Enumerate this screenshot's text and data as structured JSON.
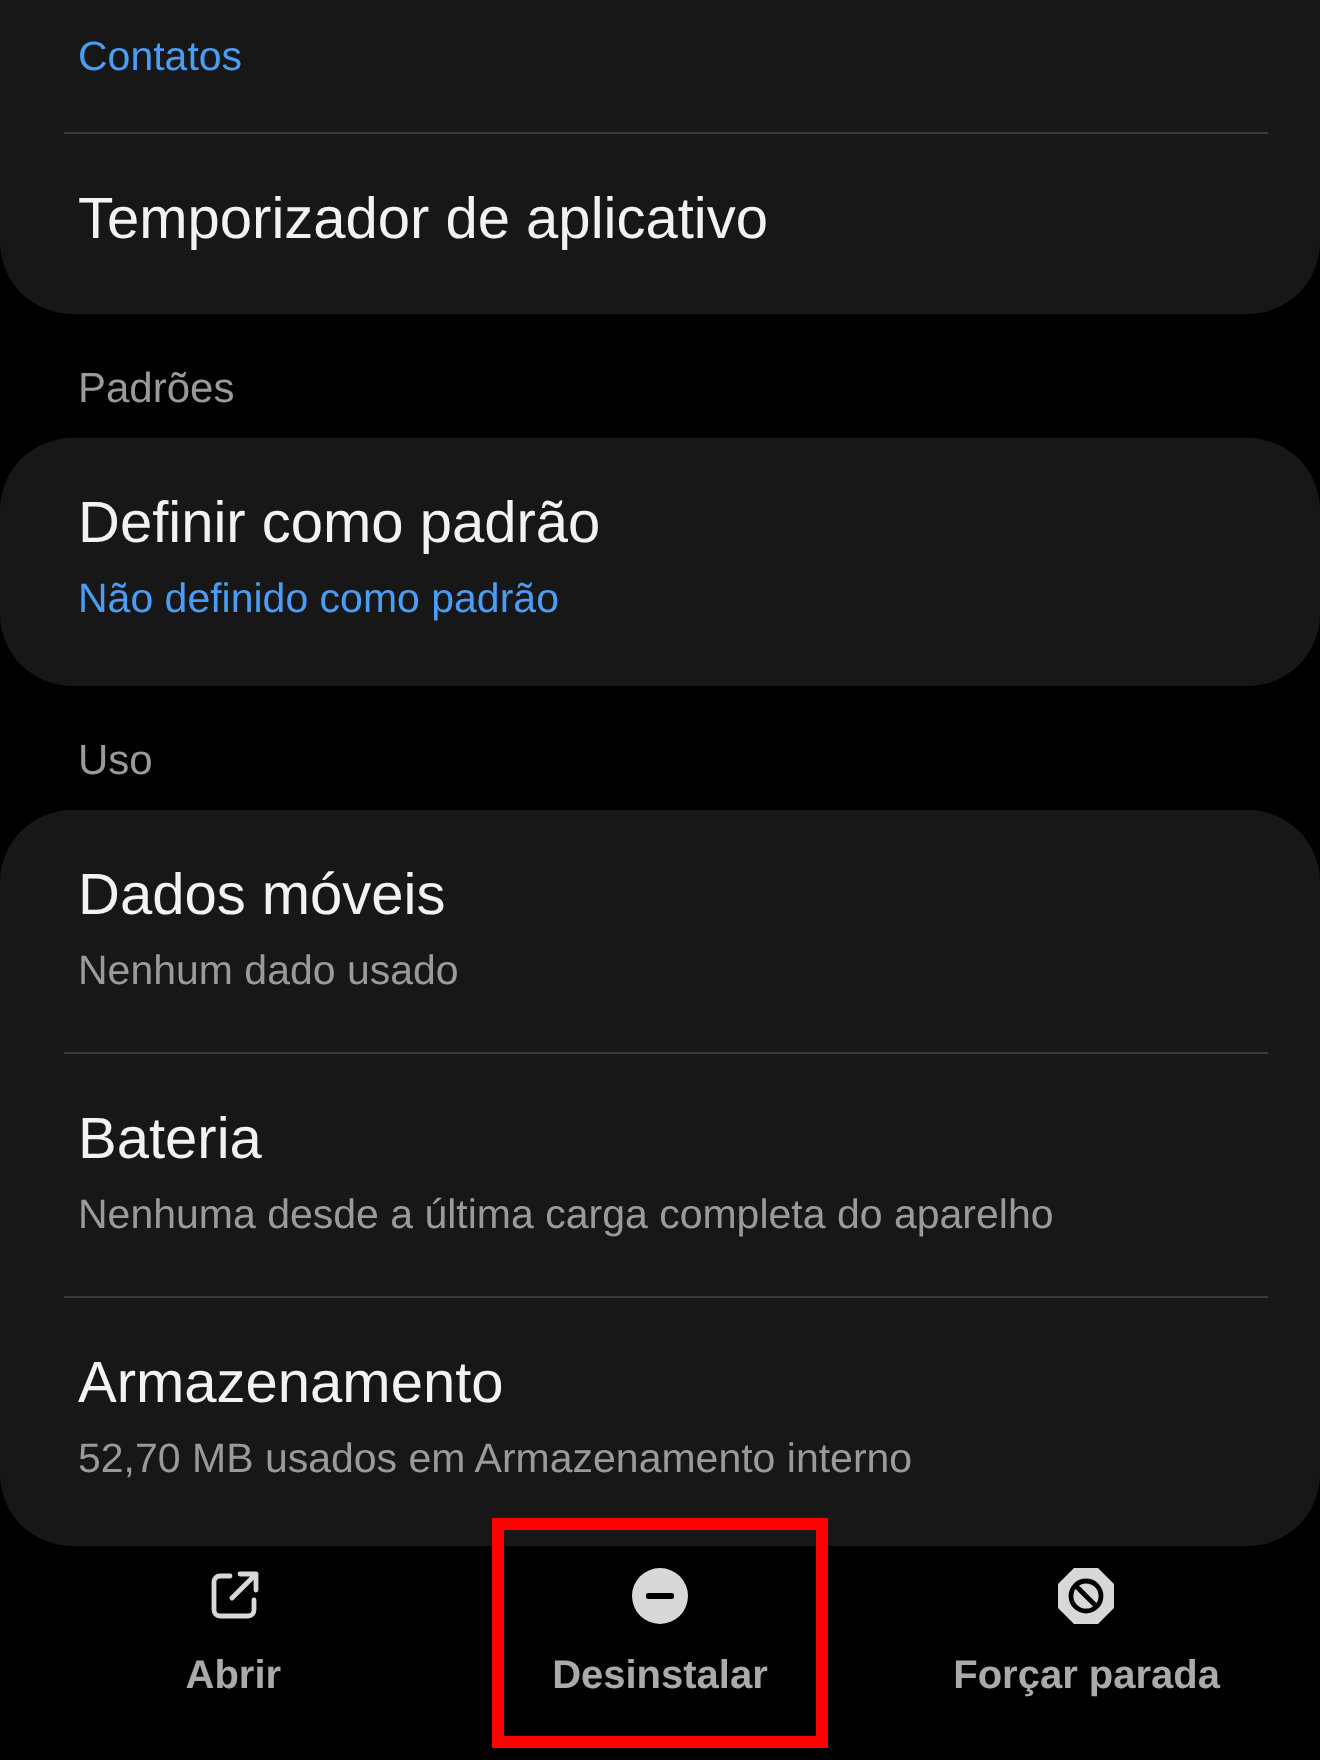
{
  "groups": [
    {
      "items": [
        {
          "subtitle": "Contatos",
          "kind": "link"
        },
        {
          "title": "Temporizador de aplicativo"
        }
      ]
    },
    {
      "header": "Padrões",
      "items": [
        {
          "title": "Definir como padrão",
          "subtitle": "Não definido como padrão",
          "kind": "link"
        }
      ]
    },
    {
      "header": "Uso",
      "items": [
        {
          "title": "Dados móveis",
          "subtitle": "Nenhum dado usado",
          "kind": "plain"
        },
        {
          "title": "Bateria",
          "subtitle": "Nenhuma desde a última carga completa do aparelho",
          "kind": "plain"
        },
        {
          "title": "Armazenamento",
          "subtitle": "52,70 MB usados em Armazenamento interno",
          "kind": "plain"
        }
      ]
    }
  ],
  "actions": [
    {
      "label": "Abrir",
      "kind": "open",
      "highlighted": false
    },
    {
      "label": "Desinstalar",
      "kind": "uninstall",
      "highlighted": true
    },
    {
      "label": "Forçar parada",
      "kind": "stop",
      "highlighted": false
    }
  ]
}
